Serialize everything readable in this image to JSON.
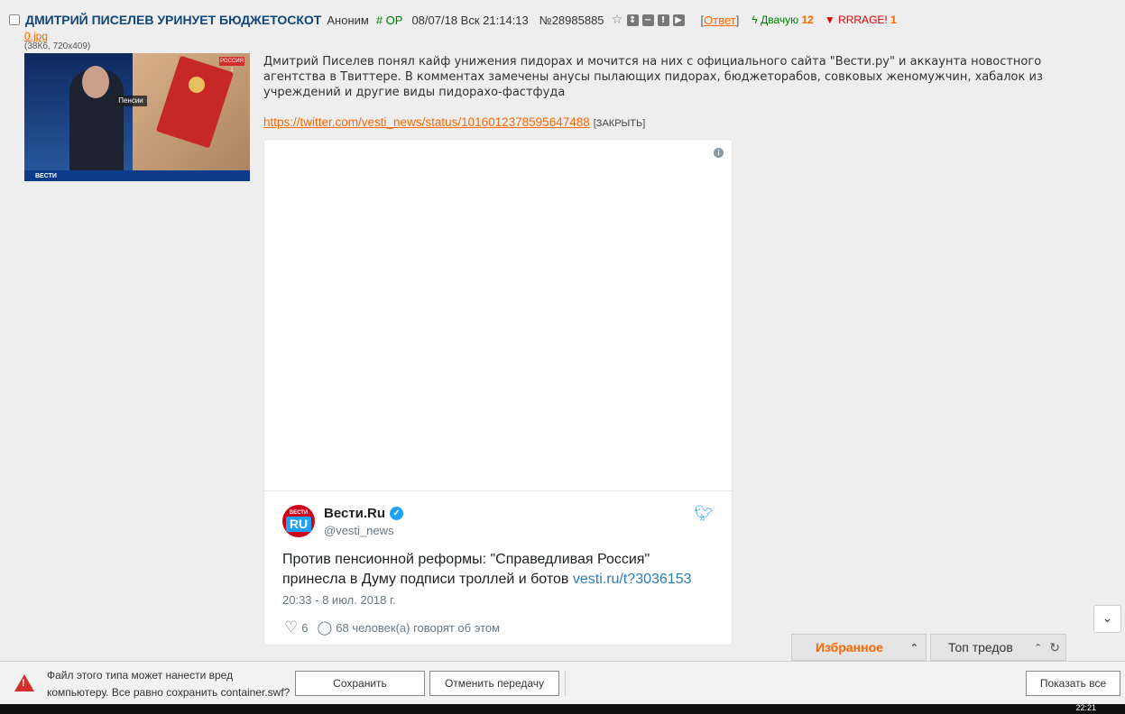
{
  "post": {
    "subject": "ДМИТРИЙ ПИСЕЛЕВ УРИНУЕТ БЮДЖЕТОСКОТ",
    "name": "Аноним",
    "op_badge": "# OP",
    "date": "08/07/18 Вск 21:14:13",
    "number": "№28985885",
    "reply_label": "Ответ",
    "like_label": "Двачую",
    "like_count": "12",
    "dislike_label": "RRRAGE!",
    "dislike_count": "1",
    "file_name": "0.jpg",
    "file_meta": "(38Кб, 720x409)",
    "thumb_tag": "Пенсии",
    "thumb_channel": "РОССИЯ 1",
    "thumb_logo": "ВЕСТИ",
    "text": "Дмитрий Писелев понял кайф унижения пидорах и мочится на них с официального сайта \"Вести.ру\" и аккаунта новостного агентства в Твиттере. В комментах замечены анусы пылающих пидорах, бюджеторабов, совковых женомужчин, хабалок из учреждений и другие виды пидорахо-фастфуда",
    "link": "https://twitter.com/vesti_news/status/1016012378595647488",
    "close_label": "[ЗАКРЫТЬ]"
  },
  "tweet": {
    "avatar_top": "ВЕСТИ",
    "avatar_ru": "RU",
    "name": "Вести.Ru",
    "handle": "@vesti_news",
    "text": "Против пенсионной реформы: \"Справедливая Россия\" принесла в Думу подписи троллей и ботов ",
    "text_link": "vesti.ru/t?3036153",
    "date": "20:33 - 8 июл. 2018 г.",
    "likes": "6",
    "comments": "68 человек(а) говорят об этом"
  },
  "tabs": {
    "favorites": "Избранное",
    "top_threads": "Топ тредов"
  },
  "download_bar": {
    "warning": "Файл этого типа может нанести вред компьютеру. Все равно сохранить container.swf?",
    "save": "Сохранить",
    "cancel": "Отменить передачу",
    "show_all": "Показать все"
  },
  "taskbar": {
    "clock": "22:21"
  },
  "colors": {
    "accent": "#ff6600",
    "subject": "#10467a",
    "twitter_blue": "#1da1f2"
  }
}
